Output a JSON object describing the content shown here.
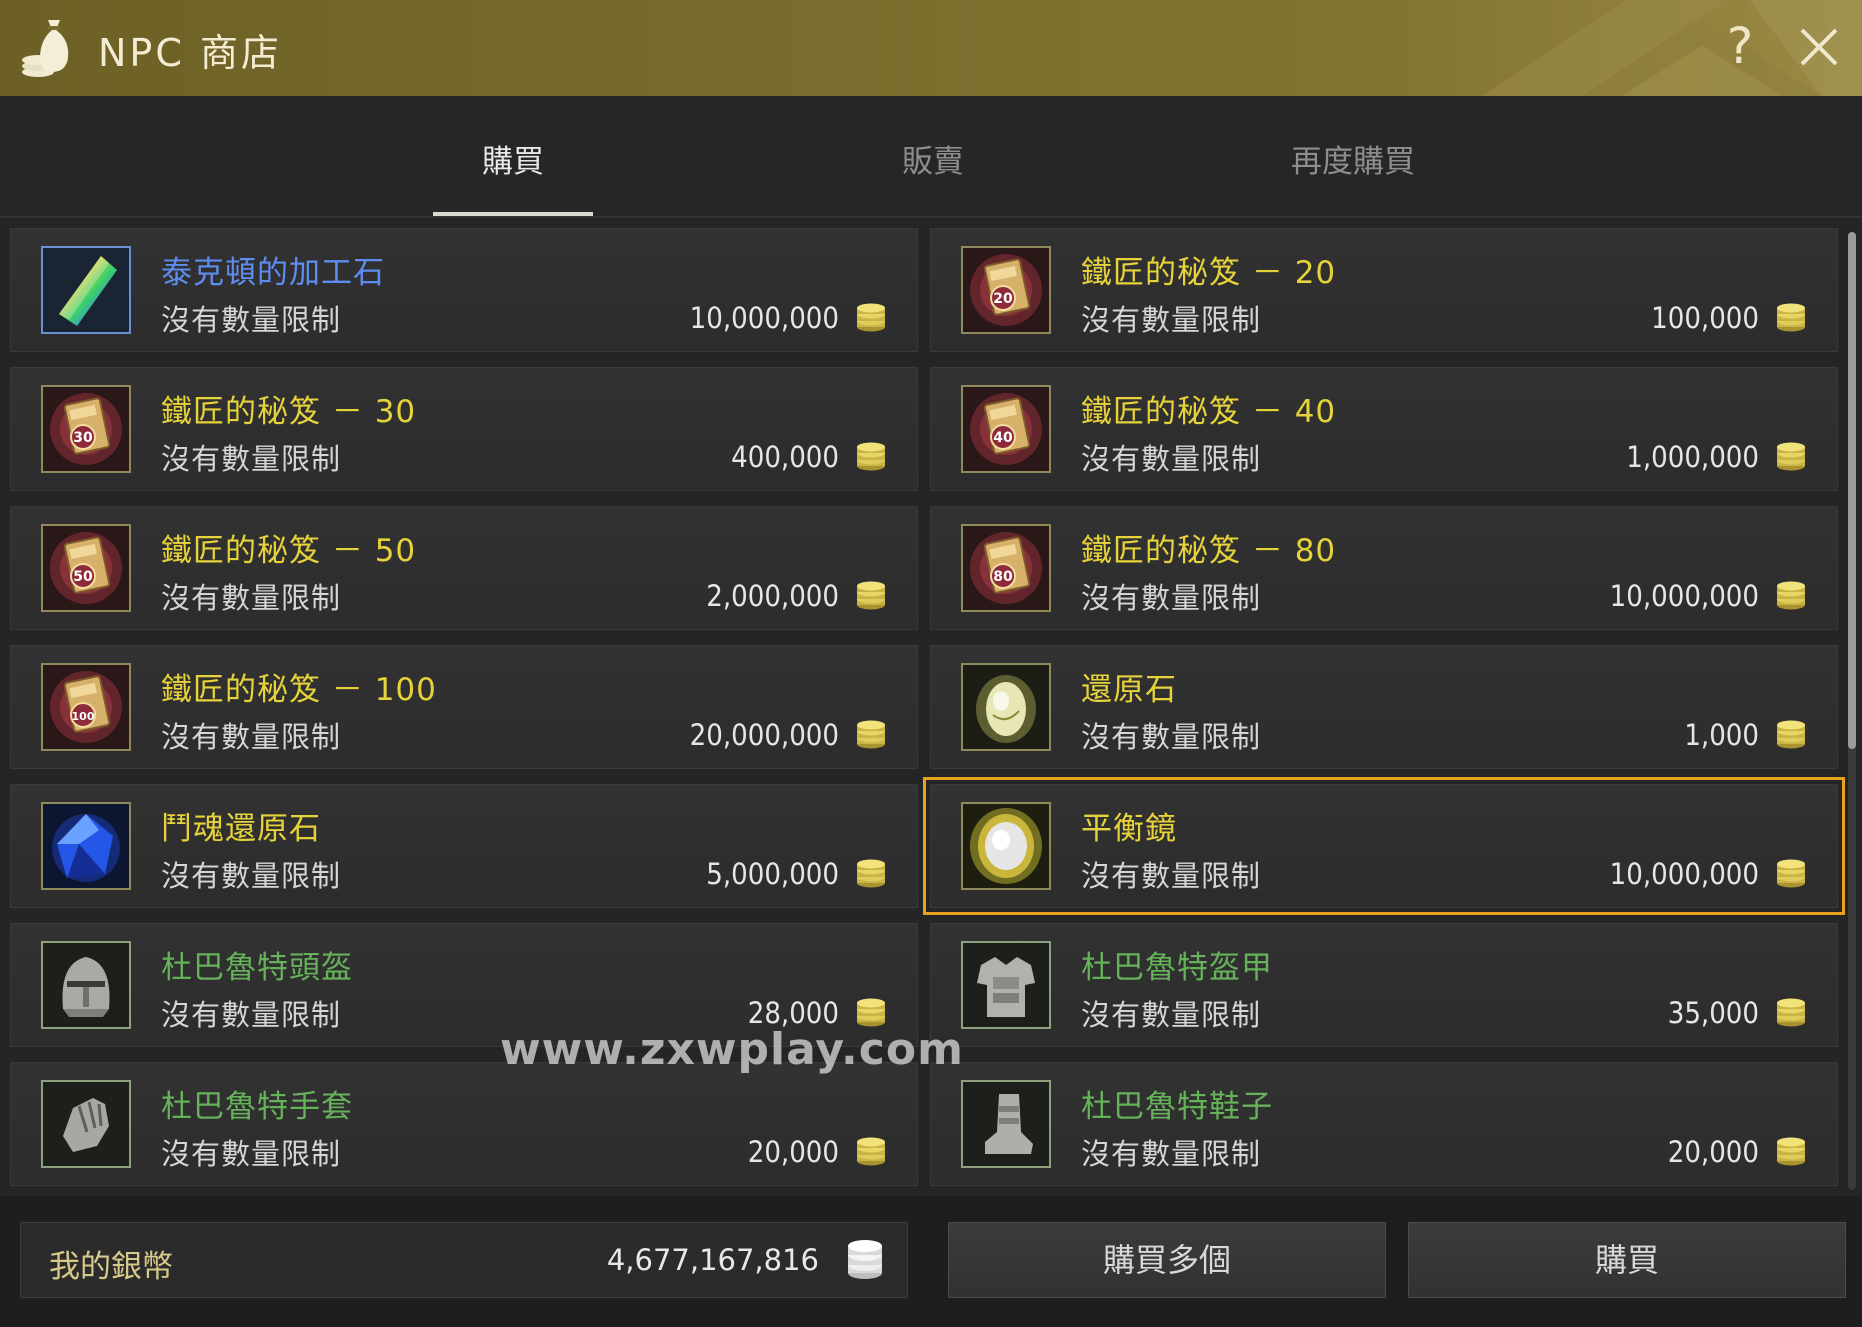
{
  "window": {
    "title": "NPC 商店",
    "help_label": "?"
  },
  "tabs": [
    {
      "label": "購買",
      "active": true
    },
    {
      "label": "販賣",
      "active": false
    },
    {
      "label": "再度購買",
      "active": false
    }
  ],
  "items": [
    {
      "name": "泰克頓的加工石",
      "limit": "沒有數量限制",
      "price": "10,000,000",
      "name_color": "blue",
      "icon": "rainbow-crystal-icon"
    },
    {
      "name": "鐵匠的秘笈 － 20",
      "limit": "沒有數量限制",
      "price": "100,000",
      "name_color": "yellow",
      "icon": "blacksmith-book-20-icon",
      "badge": "20"
    },
    {
      "name": "鐵匠的秘笈 － 30",
      "limit": "沒有數量限制",
      "price": "400,000",
      "name_color": "yellow",
      "icon": "blacksmith-book-30-icon",
      "badge": "30"
    },
    {
      "name": "鐵匠的秘笈 － 40",
      "limit": "沒有數量限制",
      "price": "1,000,000",
      "name_color": "yellow",
      "icon": "blacksmith-book-40-icon",
      "badge": "40"
    },
    {
      "name": "鐵匠的秘笈 － 50",
      "limit": "沒有數量限制",
      "price": "2,000,000",
      "name_color": "yellow",
      "icon": "blacksmith-book-50-icon",
      "badge": "50"
    },
    {
      "name": "鐵匠的秘笈 － 80",
      "limit": "沒有數量限制",
      "price": "10,000,000",
      "name_color": "yellow",
      "icon": "blacksmith-book-80-icon",
      "badge": "80"
    },
    {
      "name": "鐵匠的秘笈 － 100",
      "limit": "沒有數量限制",
      "price": "20,000,000",
      "name_color": "yellow",
      "icon": "blacksmith-book-100-icon",
      "badge": "100"
    },
    {
      "name": "還原石",
      "limit": "沒有數量限制",
      "price": "1,000",
      "name_color": "yellow",
      "icon": "restoration-stone-icon"
    },
    {
      "name": "鬥魂還原石",
      "limit": "沒有數量限制",
      "price": "5,000,000",
      "name_color": "yellow",
      "icon": "fighting-spirit-stone-icon"
    },
    {
      "name": "平衡鏡",
      "limit": "沒有數量限制",
      "price": "10,000,000",
      "name_color": "yellow",
      "icon": "balance-mirror-icon",
      "selected": true
    },
    {
      "name": "杜巴魯特頭盔",
      "limit": "沒有數量限制",
      "price": "28,000",
      "name_color": "green",
      "icon": "helmet-icon"
    },
    {
      "name": "杜巴魯特盔甲",
      "limit": "沒有數量限制",
      "price": "35,000",
      "name_color": "green",
      "icon": "armor-icon"
    },
    {
      "name": "杜巴魯特手套",
      "limit": "沒有數量限制",
      "price": "20,000",
      "name_color": "green",
      "icon": "gloves-icon"
    },
    {
      "name": "杜巴魯特鞋子",
      "limit": "沒有數量限制",
      "price": "20,000",
      "name_color": "green",
      "icon": "boots-icon"
    }
  ],
  "watermark": "www.zxwplay.com",
  "footer": {
    "wallet_label": "我的銀幣",
    "wallet_value": "4,677,167,816",
    "buy_multiple_label": "購買多個",
    "buy_label": "購買"
  },
  "colors": {
    "accent_selected": "#e8a21e",
    "title_bar": "#7a6c2c",
    "name_yellow": "#e6d23a",
    "name_blue": "#5f8cf0",
    "name_green": "#66b25a"
  },
  "scroll": {
    "position_fraction": 0.0,
    "visible_fraction": 0.54
  }
}
